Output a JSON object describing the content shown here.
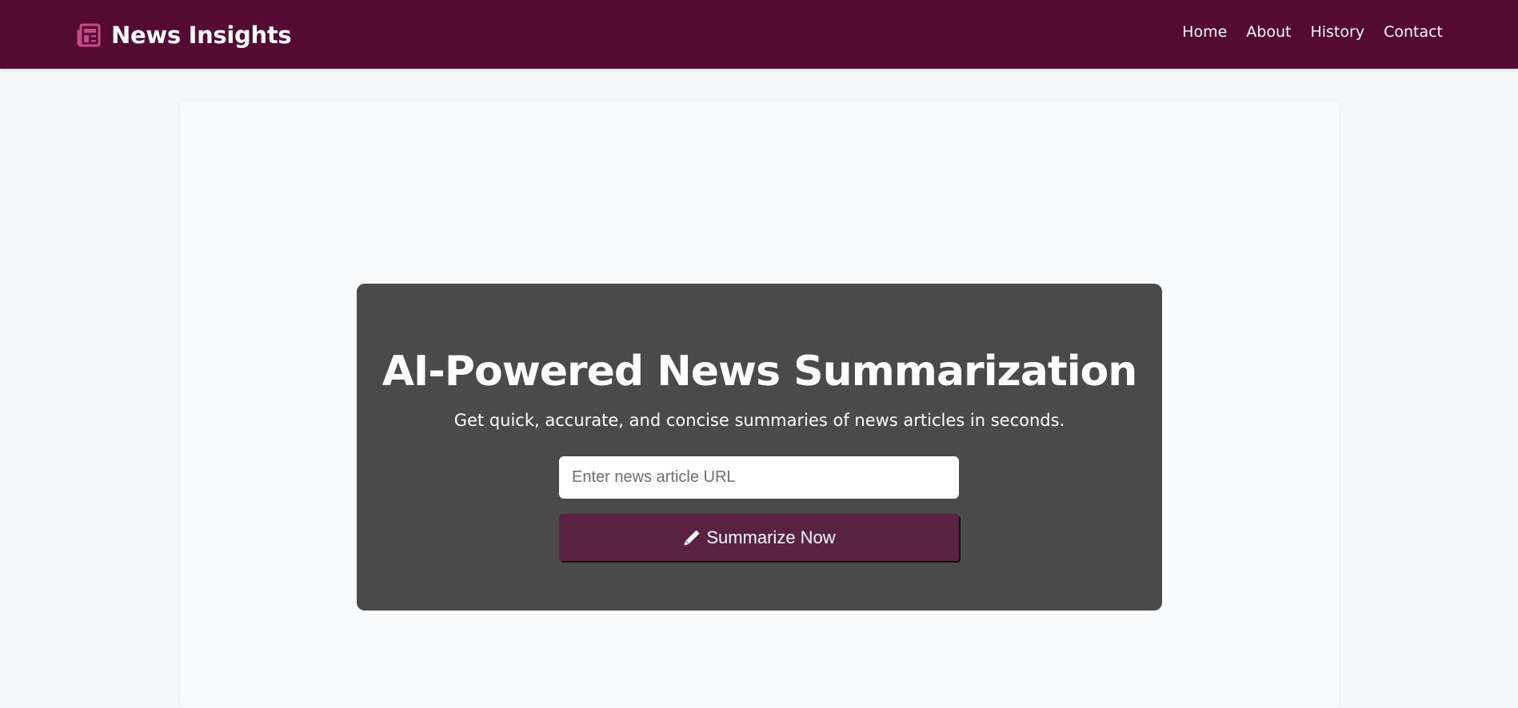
{
  "navbar": {
    "brand_title": "News Insights",
    "brand_icon": "newspaper-icon",
    "links": [
      "Home",
      "About",
      "History",
      "Contact"
    ]
  },
  "hero": {
    "title": "AI-Powered News Summarization",
    "subtitle": "Get quick, accurate, and concise summaries of news articles in seconds.",
    "url_input": {
      "value": "",
      "placeholder": "Enter news article URL"
    },
    "summarize_button": {
      "label": "Summarize Now",
      "icon": "pencil-icon"
    }
  },
  "colors": {
    "navbar_bg": "#540a33",
    "brand_icon": "#c74a8a",
    "hero_bg": "#4a4a4a",
    "button_bg": "#5a2242",
    "page_bg": "#f7f8fa"
  }
}
